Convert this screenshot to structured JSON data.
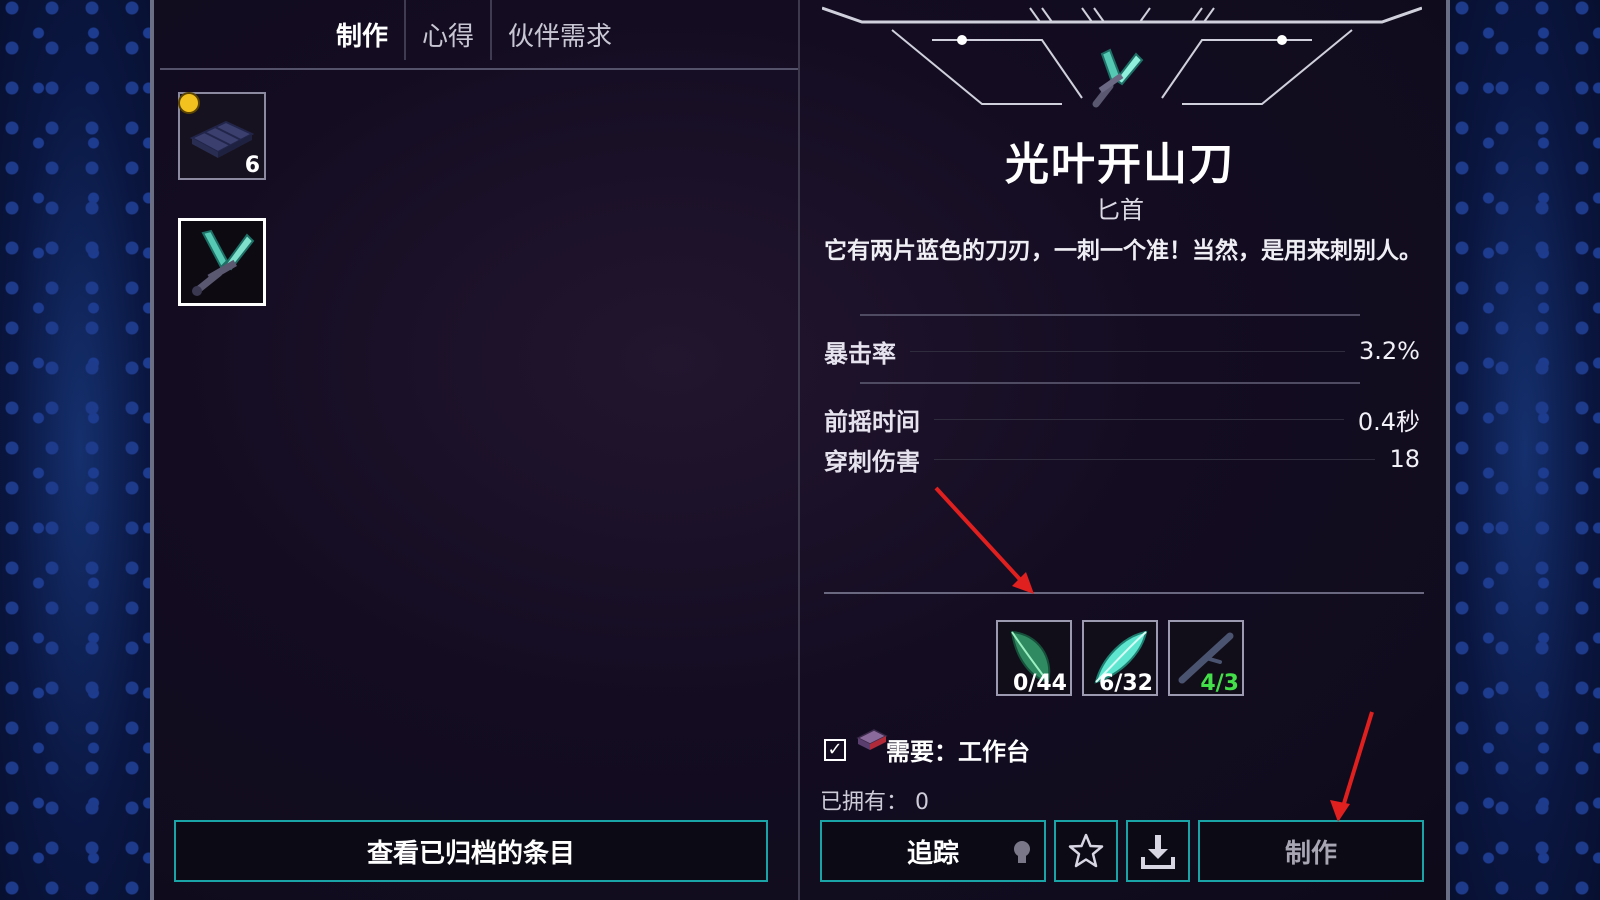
{
  "tabs": [
    {
      "label": "制作",
      "active": true
    },
    {
      "label": "心得",
      "active": false
    },
    {
      "label": "伙伴需求",
      "active": false
    }
  ],
  "recipes": [
    {
      "icon": "wood-plank-icon",
      "count": "6",
      "marked": true
    },
    {
      "icon": "twin-blade-dagger-icon",
      "count": "",
      "selected": true
    }
  ],
  "archive_button": "查看已归档的条目",
  "item": {
    "name": "光叶开山刀",
    "type": "匕首",
    "description": "它有两片蓝色的刀刃，一刺一个准！当然，是用来刺别人。"
  },
  "stats": [
    {
      "label": "暴击率",
      "value": "3.2%"
    },
    {
      "label": "前摇时间",
      "value": "0.4秒"
    },
    {
      "label": "穿刺伤害",
      "value": "18"
    }
  ],
  "materials": [
    {
      "icon": "green-leaf-icon",
      "count": "0/44",
      "sufficient": false
    },
    {
      "icon": "cyan-leaf-blade-icon",
      "count": "6/32",
      "sufficient": false
    },
    {
      "icon": "dark-stick-icon",
      "count": "4/3",
      "sufficient": true
    }
  ],
  "requirement": {
    "checked": true,
    "text": "需要：工作台"
  },
  "owned": "已拥有： 0",
  "buttons": {
    "track": "追踪",
    "craft": "制作"
  },
  "colors": {
    "accent_border": "#1aa4a8",
    "sufficient_green": "#44e04a",
    "annotation_red": "#e0201e"
  }
}
